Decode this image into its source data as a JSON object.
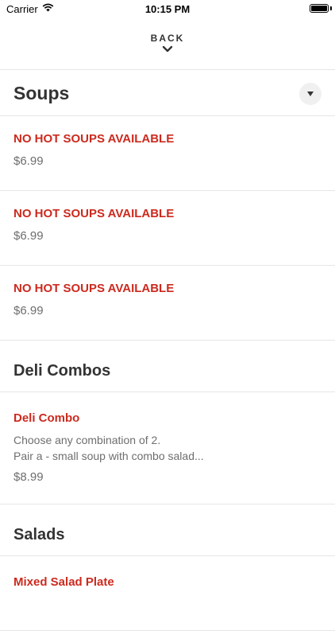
{
  "status_bar": {
    "carrier": "Carrier",
    "time": "10:15 PM"
  },
  "nav": {
    "back_label": "BACK"
  },
  "sections": [
    {
      "title": "Soups",
      "items": [
        {
          "name": "NO HOT SOUPS AVAILABLE",
          "price": "$6.99"
        },
        {
          "name": "NO HOT SOUPS AVAILABLE",
          "price": "$6.99"
        },
        {
          "name": "NO HOT SOUPS AVAILABLE",
          "price": "$6.99"
        }
      ]
    },
    {
      "title": "Deli Combos",
      "items": [
        {
          "name": "Deli Combo",
          "description": "Choose any combination of 2.\nPair a  - small soup with combo salad...",
          "price": "$8.99"
        }
      ]
    },
    {
      "title": "Salads",
      "items": [
        {
          "name": "Mixed Salad Plate"
        }
      ]
    }
  ],
  "colors": {
    "accent": "#cc2a1e",
    "text": "#333333",
    "muted": "#6e6e6e",
    "divider": "#e6e6e6"
  }
}
